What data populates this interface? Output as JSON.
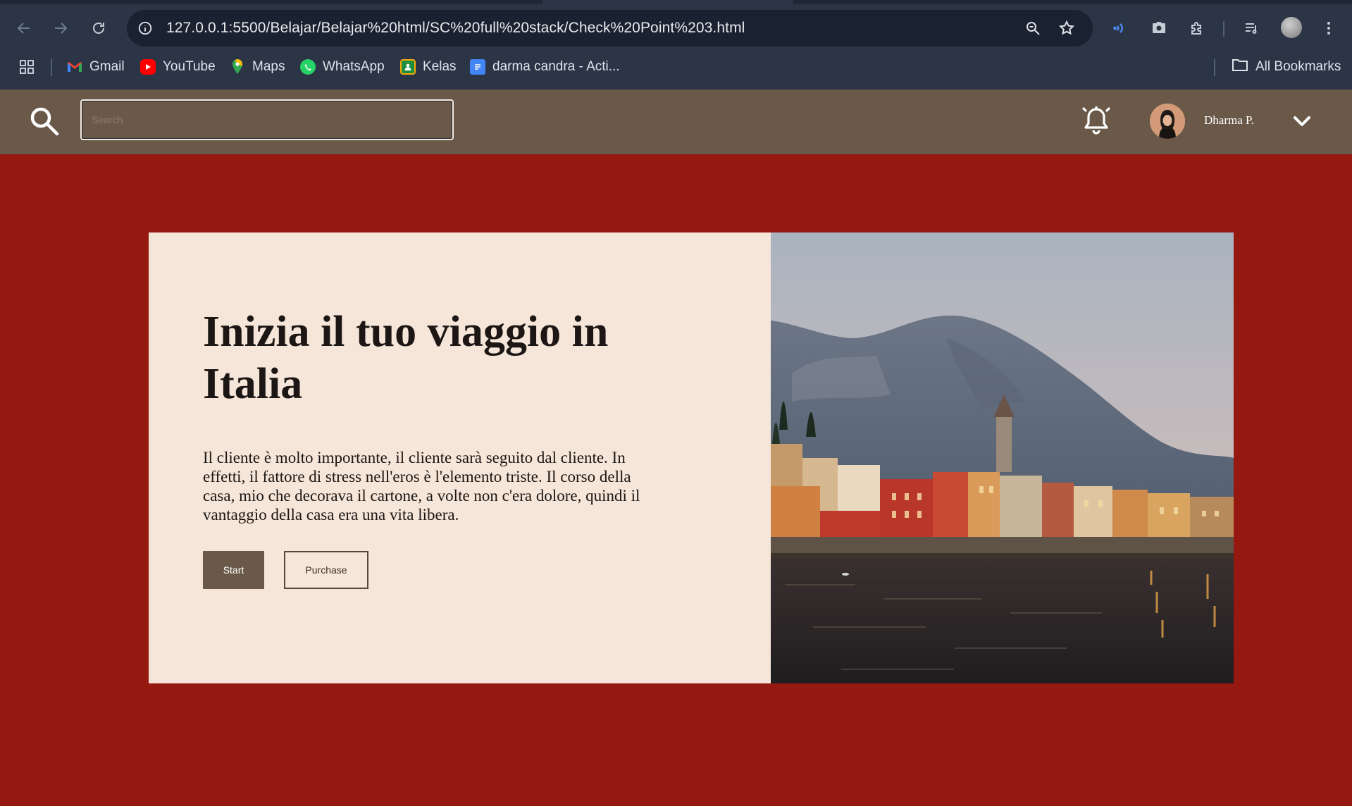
{
  "browser": {
    "url": "127.0.0.1:5500/Belajar/Belajar%20html/SC%20full%20stack/Check%20Point%203.html",
    "bookmarks": [
      {
        "label": "Gmail",
        "icon": "gmail-icon",
        "color": "#ea4335"
      },
      {
        "label": "YouTube",
        "icon": "youtube-icon",
        "color": "#ff0000"
      },
      {
        "label": "Maps",
        "icon": "maps-icon",
        "color": "#34a853"
      },
      {
        "label": "WhatsApp",
        "icon": "whatsapp-icon",
        "color": "#25d366"
      },
      {
        "label": "Kelas",
        "icon": "classroom-icon",
        "color": "#f9ab00"
      },
      {
        "label": "darma candra - Acti...",
        "icon": "docs-icon",
        "color": "#4285f4"
      }
    ],
    "all_bookmarks": "All Bookmarks"
  },
  "header": {
    "search_placeholder": "Search",
    "user_name": "Dharma P.",
    "background": "#6a5948"
  },
  "hero": {
    "title": "Inizia il tuo viaggio in Italia",
    "body": "Il cliente è molto importante, il cliente sarà seguito dal cliente. In effetti, il fattore di stress nell'eros è l'elemento triste. Il corso della casa, mio che decorava il cartone, a volte non c'era dolore, quindi il vantaggio della casa era una vita libera.",
    "start_label": "Start",
    "purchase_label": "Purchase",
    "card_background": "#f6e6da"
  },
  "page": {
    "background": "#951811"
  }
}
